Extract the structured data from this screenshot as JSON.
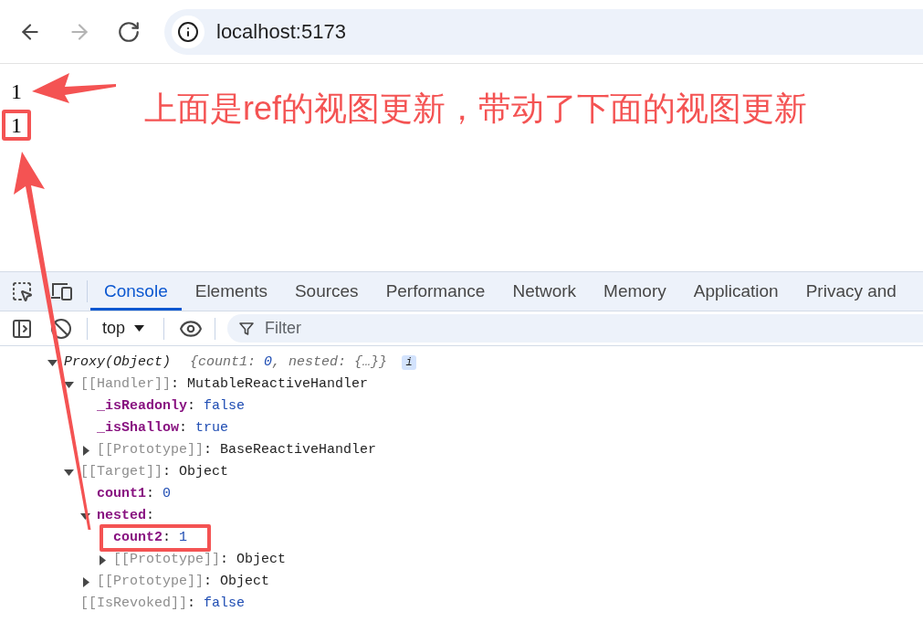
{
  "browser": {
    "nav_buttons": [
      {
        "kind": "back",
        "disabled": false
      },
      {
        "kind": "forward",
        "disabled": true
      },
      {
        "kind": "reload",
        "disabled": false
      }
    ],
    "address": "localhost:5173"
  },
  "page": {
    "lines": [
      {
        "text": "1",
        "highlighted": false
      },
      {
        "text": "1",
        "highlighted": true
      }
    ],
    "annotation": "上面是ref的视图更新，带动了下面的视图更新"
  },
  "devtools": {
    "tabs": [
      {
        "label": "Console",
        "selected": true
      },
      {
        "label": "Elements",
        "selected": false
      },
      {
        "label": "Sources",
        "selected": false
      },
      {
        "label": "Performance",
        "selected": false
      },
      {
        "label": "Network",
        "selected": false
      },
      {
        "label": "Memory",
        "selected": false
      },
      {
        "label": "Application",
        "selected": false
      },
      {
        "label": "Privacy and",
        "selected": false
      }
    ],
    "context": "top",
    "filter": {
      "placeholder": "Filter"
    },
    "console": {
      "tree": {
        "kind": "object",
        "label": "Proxy(Object)",
        "preview": [
          {
            "text": "{count1: ",
            "kind": "punct"
          },
          {
            "text": "0",
            "kind": "number"
          },
          {
            "text": ", nested: {…}}",
            "kind": "punct"
          }
        ],
        "info": "i",
        "expanded": true,
        "children": [
          {
            "key": "[[Handler]]",
            "kind": "internal",
            "sep": ": ",
            "value": {
              "text": "MutableReactiveHandler",
              "kind": "object"
            },
            "expanded": true,
            "highlighted": false,
            "children": [
              {
                "key": "_isReadonly",
                "kind": "property",
                "sep": ": ",
                "value": {
                  "text": "false",
                  "kind": "boolean"
                },
                "highlighted": false
              },
              {
                "key": "_isShallow",
                "kind": "property",
                "sep": ": ",
                "value": {
                  "text": "true",
                  "kind": "boolean"
                },
                "highlighted": false
              },
              {
                "key": "[[Prototype]]",
                "kind": "internal",
                "sep": ": ",
                "value": {
                  "text": "BaseReactiveHandler",
                  "kind": "object"
                },
                "expanded": false,
                "highlighted": false
              }
            ]
          },
          {
            "key": "[[Target]]",
            "kind": "internal",
            "sep": ": ",
            "value": {
              "text": "Object",
              "kind": "object"
            },
            "expanded": true,
            "highlighted": false,
            "children": [
              {
                "key": "count1",
                "kind": "property",
                "sep": ": ",
                "value": {
                  "text": "0",
                  "kind": "number"
                },
                "highlighted": false
              },
              {
                "key": "nested",
                "kind": "property",
                "sep": ":",
                "expanded": true,
                "highlighted": false,
                "children": [
                  {
                    "key": "count2",
                    "kind": "property",
                    "sep": ": ",
                    "value": {
                      "text": "1",
                      "kind": "number"
                    },
                    "highlighted": true
                  },
                  {
                    "key": "[[Prototype]]",
                    "kind": "internal",
                    "sep": ": ",
                    "value": {
                      "text": "Object",
                      "kind": "object"
                    },
                    "expanded": false,
                    "highlighted": false
                  }
                ]
              },
              {
                "key": "[[Prototype]]",
                "kind": "internal",
                "sep": ": ",
                "value": {
                  "text": "Object",
                  "kind": "object"
                },
                "expanded": false,
                "highlighted": false
              }
            ]
          },
          {
            "key": "[[IsRevoked]]",
            "kind": "internal",
            "sep": ": ",
            "value": {
              "text": "false",
              "kind": "boolean"
            },
            "highlighted": false
          }
        ]
      }
    }
  }
}
